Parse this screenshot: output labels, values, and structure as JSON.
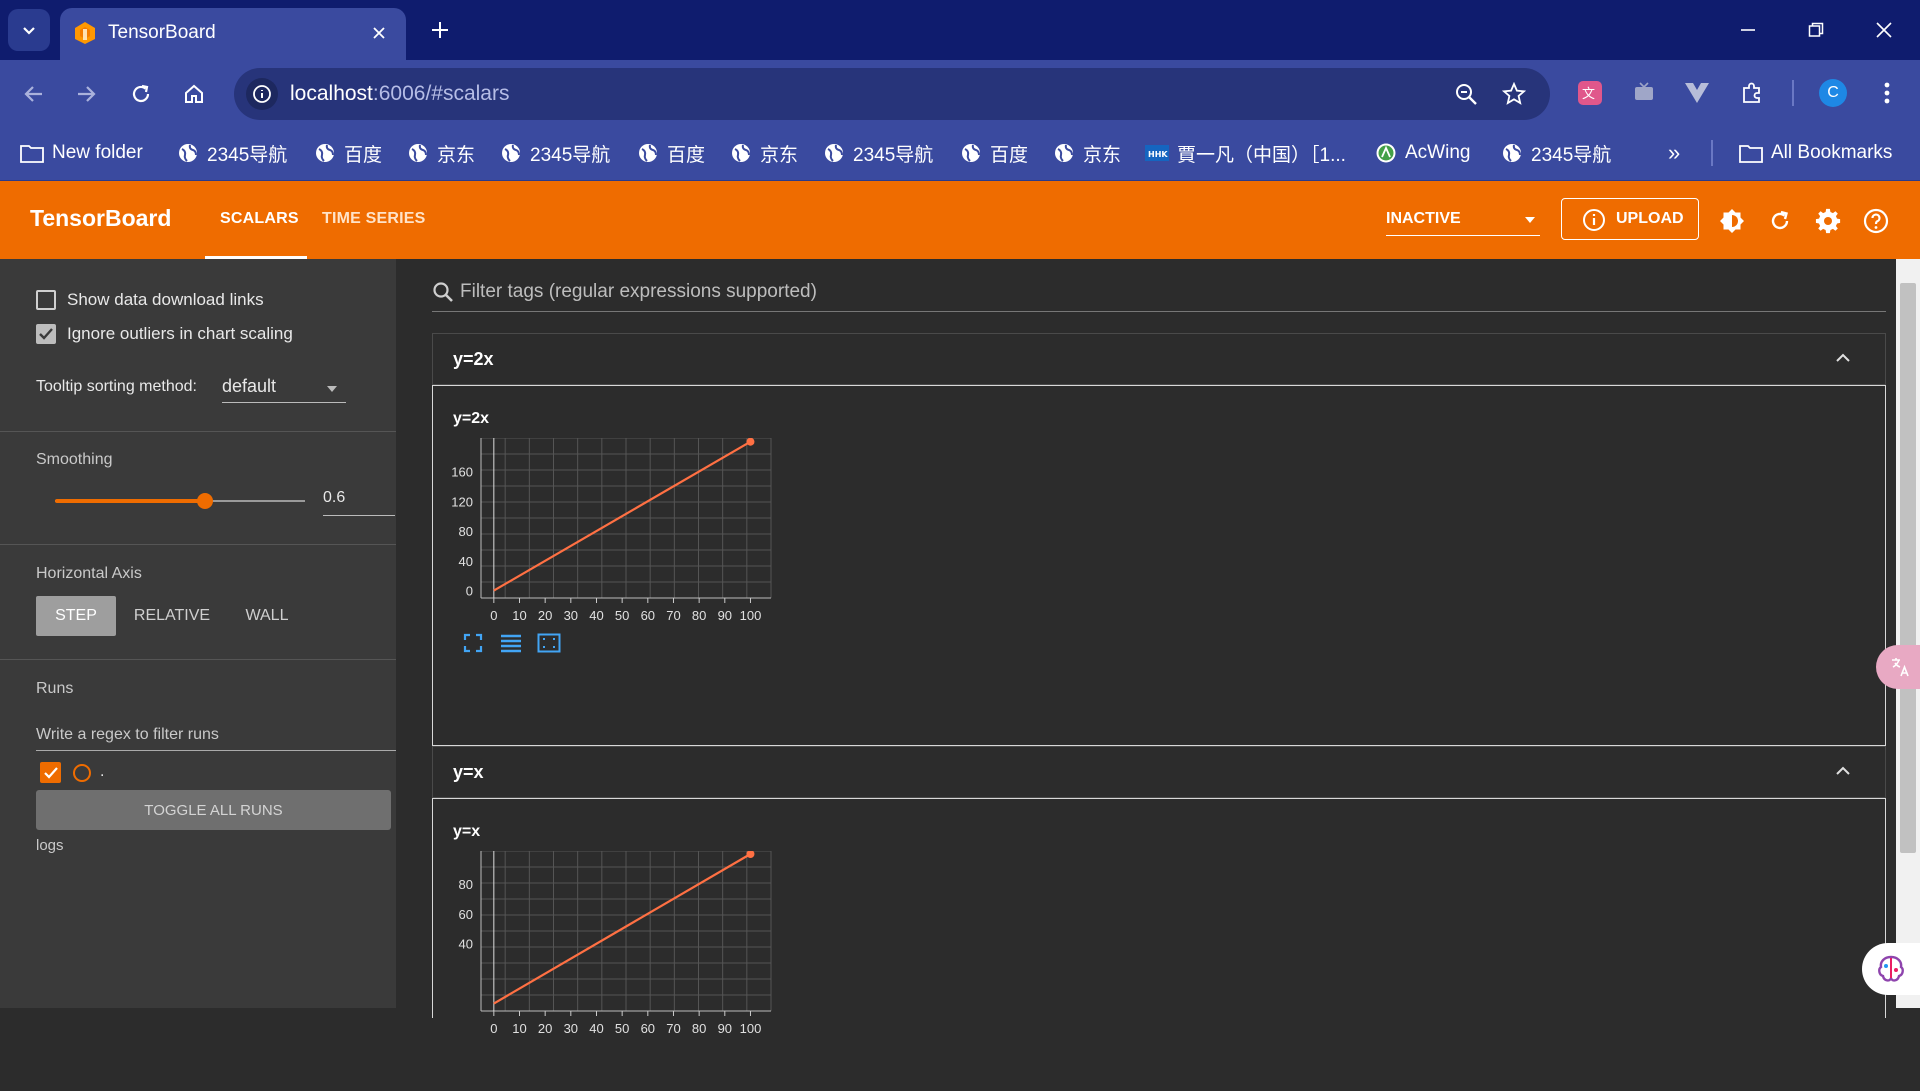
{
  "browser": {
    "tab_title": "TensorBoard",
    "url_host": "localhost",
    "url_rest": ":6006/#scalars",
    "profile_letter": "C",
    "bookmarks": [
      {
        "label": "New folder",
        "icon": "folder-icon"
      },
      {
        "label": "2345导航",
        "icon": "globe-icon"
      },
      {
        "label": "百度",
        "icon": "globe-icon"
      },
      {
        "label": "京东",
        "icon": "globe-icon"
      },
      {
        "label": "2345导航",
        "icon": "globe-icon"
      },
      {
        "label": "百度",
        "icon": "globe-icon"
      },
      {
        "label": "京东",
        "icon": "globe-icon"
      },
      {
        "label": "2345导航",
        "icon": "globe-icon"
      },
      {
        "label": "百度",
        "icon": "globe-icon"
      },
      {
        "label": "京东",
        "icon": "globe-icon"
      },
      {
        "label": "賈一凡（中国）［1...",
        "icon": "site-badge-icon"
      },
      {
        "label": "AcWing",
        "icon": "acwing-icon"
      },
      {
        "label": "2345导航",
        "icon": "globe-icon"
      }
    ],
    "overflow_label": "»",
    "all_bookmarks_label": "All Bookmarks"
  },
  "tensorboard": {
    "brand": "TensorBoard",
    "tabs": [
      "SCALARS",
      "TIME SERIES"
    ],
    "run_state": "INACTIVE",
    "upload_label": "UPLOAD",
    "accent_color": "#ef6c00"
  },
  "sidebar": {
    "show_download_links_label": "Show data download links",
    "ignore_outliers_label": "Ignore outliers in chart scaling",
    "ignore_outliers_checked": true,
    "show_download_links_checked": false,
    "tooltip_sorting_label": "Tooltip sorting method:",
    "tooltip_sorting_value": "default",
    "smoothing_label": "Smoothing",
    "smoothing_value": "0.6",
    "smoothing_fraction": 0.6,
    "horizontal_axis_label": "Horizontal Axis",
    "axis_options": [
      "STEP",
      "RELATIVE",
      "WALL"
    ],
    "axis_selected": "STEP",
    "runs_label": "Runs",
    "runs_filter_placeholder": "Write a regex to filter runs",
    "run_name": ".",
    "toggle_all_runs_label": "TOGGLE ALL RUNS",
    "logdir_label": "logs"
  },
  "main": {
    "filter_placeholder": "Filter tags (regular expressions supported)"
  },
  "chart_data": [
    {
      "type": "line",
      "title": "y=2x",
      "x": [
        0,
        100
      ],
      "y": [
        0,
        200
      ],
      "xlim": [
        -5,
        108
      ],
      "ylim": [
        -10,
        205
      ],
      "xticks": [
        0,
        10,
        20,
        30,
        40,
        50,
        60,
        70,
        80,
        90,
        100
      ],
      "yticks": [
        0,
        40,
        80,
        120,
        160
      ],
      "grid": true,
      "series": [
        {
          "values": [
            0,
            200
          ],
          "color": "#ff7043"
        }
      ]
    },
    {
      "type": "line",
      "title": "y=x",
      "x": [
        0,
        100
      ],
      "y": [
        0,
        100
      ],
      "xlim": [
        -5,
        108
      ],
      "ylim": [
        -5,
        102
      ],
      "xticks": [
        0,
        10,
        20,
        30,
        40,
        50,
        60,
        70,
        80,
        90,
        100
      ],
      "yticks": [
        40,
        60,
        80
      ],
      "grid": true,
      "series": [
        {
          "values": [
            0,
            100
          ],
          "color": "#ff7043"
        }
      ]
    }
  ]
}
